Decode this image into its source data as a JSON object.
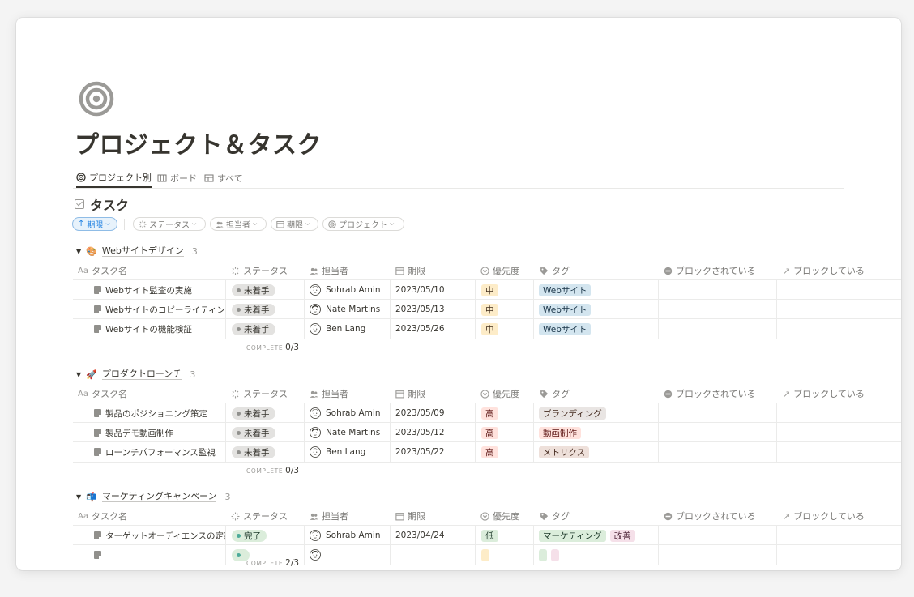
{
  "page": {
    "title": "プロジェクト＆タスク",
    "icon": "target-icon"
  },
  "view_tabs": [
    {
      "label": "プロジェクト別",
      "icon": "target-icon",
      "active": true
    },
    {
      "label": "ボード",
      "icon": "board-icon",
      "active": false
    },
    {
      "label": "すべて",
      "icon": "table-icon",
      "active": false
    }
  ],
  "database": {
    "title": "タスク",
    "icon": "checkbox-icon"
  },
  "filters": [
    {
      "label": "期限",
      "icon": "arrow-up-icon",
      "active": true
    },
    {
      "label": "ステータス",
      "icon": "status-spinner-icon",
      "active": false
    },
    {
      "label": "担当者",
      "icon": "people-icon",
      "active": false
    },
    {
      "label": "期限",
      "icon": "calendar-icon",
      "active": false
    },
    {
      "label": "プロジェクト",
      "icon": "target-icon",
      "active": false
    }
  ],
  "columns": {
    "title": "タスク名",
    "title_prefix": "Aa",
    "status": "ステータス",
    "owner": "担当者",
    "due": "期限",
    "priority": "優先度",
    "tags": "タグ",
    "blocked_by": "ブロックされている",
    "blocking": "ブロックしている"
  },
  "colors": {
    "accent": "#2383e2",
    "tag_web_bg": "#d3e5ef",
    "tag_web_fg": "#183347",
    "priority_mid_bg": "#fdecc8",
    "priority_mid_fg": "#402c1b",
    "priority_high_bg": "#ffe2dd",
    "priority_high_fg": "#5d1715",
    "priority_low_bg": "#dbeddb",
    "priority_low_fg": "#1c3829"
  },
  "groups": [
    {
      "emoji": "🎨",
      "name": "Webサイトデザイン",
      "count": "3",
      "complete_label": "COMPLETE",
      "complete_value": "0/3",
      "rows": [
        {
          "title": "Webサイト監査の実施",
          "status": "未着手",
          "status_kind": "todo",
          "owner": "Sohrab Amin",
          "due": "2023/05/10",
          "priority": "中",
          "priority_kind": "mid",
          "tags": [
            {
              "label": "Webサイト",
              "bg": "#d3e5ef",
              "fg": "#183347"
            }
          ]
        },
        {
          "title": "Webサイトのコピーライティング",
          "status": "未着手",
          "status_kind": "todo",
          "owner": "Nate Martins",
          "due": "2023/05/13",
          "priority": "中",
          "priority_kind": "mid",
          "tags": [
            {
              "label": "Webサイト",
              "bg": "#d3e5ef",
              "fg": "#183347"
            }
          ]
        },
        {
          "title": "Webサイトの機能検証",
          "status": "未着手",
          "status_kind": "todo",
          "owner": "Ben Lang",
          "due": "2023/05/26",
          "priority": "中",
          "priority_kind": "mid",
          "tags": [
            {
              "label": "Webサイト",
              "bg": "#d3e5ef",
              "fg": "#183347"
            }
          ]
        }
      ]
    },
    {
      "emoji": "🚀",
      "name": "プロダクトローンチ",
      "count": "3",
      "complete_label": "COMPLETE",
      "complete_value": "0/3",
      "rows": [
        {
          "title": "製品のポジショニング策定",
          "status": "未着手",
          "status_kind": "todo",
          "owner": "Sohrab Amin",
          "due": "2023/05/09",
          "priority": "高",
          "priority_kind": "high",
          "tags": [
            {
              "label": "ブランディング",
              "bg": "#e9e5e3",
              "fg": "#442a1e"
            }
          ]
        },
        {
          "title": "製品デモ動画制作",
          "status": "未着手",
          "status_kind": "todo",
          "owner": "Nate Martins",
          "due": "2023/05/12",
          "priority": "高",
          "priority_kind": "high",
          "tags": [
            {
              "label": "動画制作",
              "bg": "#ffe2dd",
              "fg": "#5d1715"
            }
          ]
        },
        {
          "title": "ローンチパフォーマンス監視",
          "status": "未着手",
          "status_kind": "todo",
          "owner": "Ben Lang",
          "due": "2023/05/22",
          "priority": "高",
          "priority_kind": "high",
          "tags": [
            {
              "label": "メトリクス",
              "bg": "#eee0da",
              "fg": "#44291e"
            }
          ]
        }
      ]
    },
    {
      "emoji": "📬",
      "name": "マーケティングキャンペーン",
      "count": "3",
      "complete_label": "COMPLETE",
      "complete_value": "2/3",
      "rows": [
        {
          "title": "ターゲットオーディエンスの定義",
          "status": "完了",
          "status_kind": "done",
          "owner": "Sohrab Amin",
          "due": "2023/04/24",
          "priority": "低",
          "priority_kind": "low",
          "tags": [
            {
              "label": "マーケティング",
              "bg": "#dbeddb",
              "fg": "#1c3829"
            },
            {
              "label": "改善",
              "bg": "#f5e0e9",
              "fg": "#4c2337"
            }
          ]
        },
        {
          "title": "",
          "status": "",
          "status_kind": "done",
          "owner": "",
          "due": "",
          "priority": "",
          "priority_kind": "mid",
          "tags": [
            {
              "label": "",
              "bg": "#dbeddb",
              "fg": "#1c3829"
            },
            {
              "label": "",
              "bg": "#f5e0e9",
              "fg": "#4c2337"
            }
          ]
        }
      ]
    }
  ]
}
